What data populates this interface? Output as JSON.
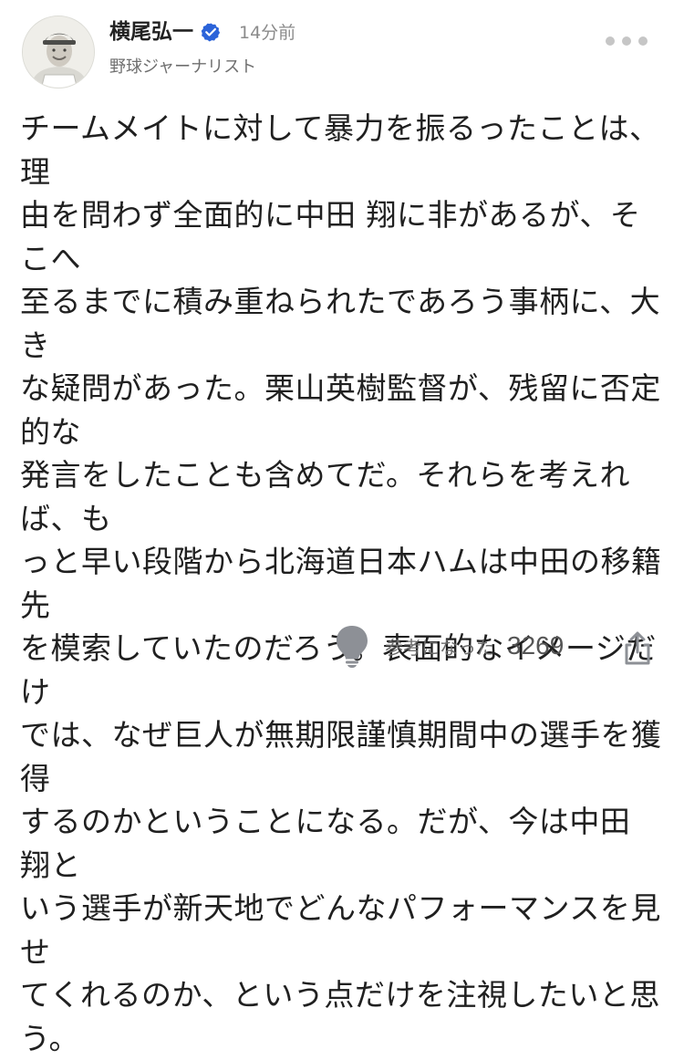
{
  "author": {
    "name": "横尾弘一",
    "verified": true,
    "time_ago": "14分前",
    "role": "野球ジャーナリスト",
    "avatar": "avatar-photo"
  },
  "more_menu": {
    "icon": "more-horizontal-icon"
  },
  "comment": {
    "text": "チームメイトに対して暴力を振るったことは、理\n由を問わず全面的に中田 翔に非があるが、そこへ\n至るまでに積み重ねられたであろう事柄に、大き\nな疑問があった。栗山英樹監督が、残留に否定的な\n発言をしたことも含めてだ。それらを考えれば、も\nっと早い段階から北海道日本ハムは中田の移籍先\nを模索していたのだろう。表面的なイメージだけ\nでは、なぜ巨人が無期限謹慎期間中の選手を獲得\nするのかということになる。だが、今は中田 翔と\nいう選手が新天地でどんなパフォーマンスを見せ\nてくれるのか、という点だけを注視したいと思う。"
  },
  "footer": {
    "helpful_label": "参考になった",
    "helpful_count": "3269",
    "helpful_icon": "lightbulb-icon",
    "share_icon": "share-icon"
  },
  "colors": {
    "verified_blue": "#2b63d9",
    "icon_gray": "#8d9096",
    "text_dark": "#202020",
    "text_muted": "#8b8b8b"
  }
}
